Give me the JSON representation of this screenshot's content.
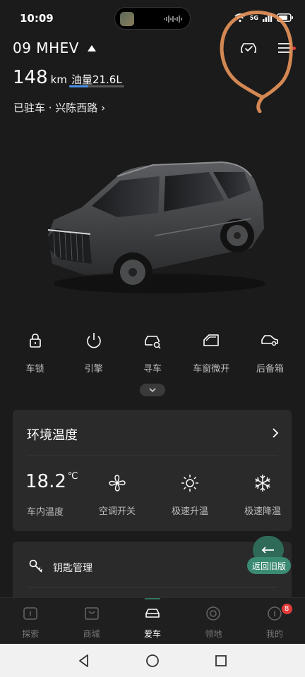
{
  "status_bar": {
    "time": "10:09",
    "network": "5G"
  },
  "header": {
    "vehicle_name": "09 MHEV",
    "range_value": "148",
    "range_unit": "km",
    "fuel_label": "油量21.6L",
    "fuel_level_fraction": 0.35,
    "parking_status": "已驻车 · 兴陈西路 ›"
  },
  "controls": [
    {
      "icon": "lock-icon",
      "label": "车锁"
    },
    {
      "icon": "power-icon",
      "label": "引擎"
    },
    {
      "icon": "find-car-icon",
      "label": "寻车"
    },
    {
      "icon": "window-icon",
      "label": "车窗微开"
    },
    {
      "icon": "trunk-icon",
      "label": "后备箱"
    }
  ],
  "climate": {
    "title": "环境温度",
    "temperature": "18.2",
    "temperature_unit": "℃",
    "temperature_label": "车内温度",
    "actions": [
      {
        "icon": "fan-icon",
        "label": "空调开关"
      },
      {
        "icon": "sun-icon",
        "label": "极速升温"
      },
      {
        "icon": "snowflake-icon",
        "label": "极速降温"
      }
    ]
  },
  "key_card": {
    "label": "钥匙管理"
  },
  "old_version": {
    "label": "返回旧版"
  },
  "bottom_nav": [
    {
      "icon": "explore-icon",
      "label": "探索",
      "active": false
    },
    {
      "icon": "shop-icon",
      "label": "商城",
      "active": false
    },
    {
      "icon": "car-icon",
      "label": "爱车",
      "active": true
    },
    {
      "icon": "territory-icon",
      "label": "领地",
      "active": false
    },
    {
      "icon": "profile-icon",
      "label": "我的",
      "active": false,
      "badge": "8"
    }
  ],
  "colors": {
    "background": "#1b1b1b",
    "card": "#2a2a2a",
    "accent_green": "#3b8a73",
    "annotation": "#e8955a",
    "badge": "#e23b3b"
  }
}
